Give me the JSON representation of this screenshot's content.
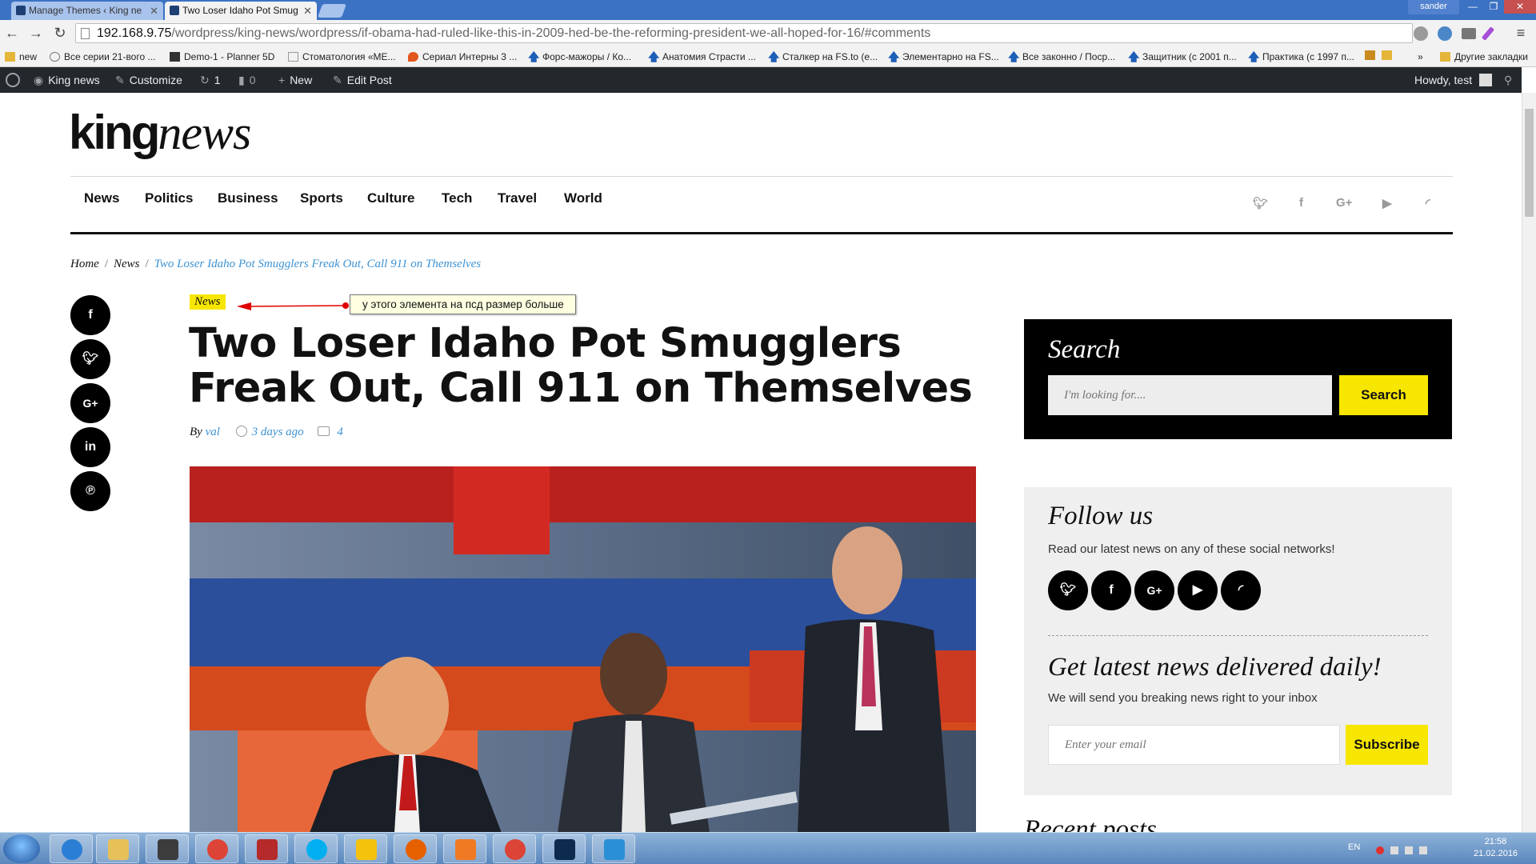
{
  "browser": {
    "tabs": [
      {
        "title": "Manage Themes ‹ King ne"
      },
      {
        "title": "Two Loser Idaho Pot Smug"
      }
    ],
    "profile_name": "sander",
    "url_host": "192.168.9.75",
    "url_path": "/wordpress/king-news/wordpress/if-obama-had-ruled-like-this-in-2009-hed-be-the-reforming-president-we-all-hoped-for-16/#comments",
    "bookmarks": [
      "new",
      "Все серии 21-вого ...",
      "Demo-1 - Planner 5D",
      "Стоматология «МЕ...",
      "Сериал Интерны 3 ...",
      "Форс-мажоры / Ко...",
      "Анатомия Страсти ...",
      "Сталкер на FS.to (е...",
      "Элементарно на FS...",
      "Все законно / Поср...",
      "Защитник (с 2001 п...",
      "Практика (с 1997 п..."
    ],
    "bookmarks_overflow": "»",
    "other_bookmarks": "Другие закладки"
  },
  "adminbar": {
    "site_name": "King news",
    "customize": "Customize",
    "updates": "1",
    "comments": "0",
    "new": "New",
    "edit_post": "Edit Post",
    "howdy": "Howdy, test"
  },
  "site": {
    "logo_bold": "king",
    "logo_italic": "news",
    "nav": [
      "News",
      "Politics",
      "Business",
      "Sports",
      "Culture",
      "Tech",
      "Travel",
      "World"
    ],
    "top_social_icons": [
      "twitter-icon",
      "facebook-icon",
      "google-plus-icon",
      "youtube-icon",
      "rss-icon"
    ]
  },
  "breadcrumb": {
    "home": "Home",
    "section": "News",
    "current": "Two Loser Idaho Pot Smugglers Freak Out, Call 911 on Themselves",
    "separator": "/"
  },
  "share_icons": [
    "facebook-icon",
    "twitter-icon",
    "google-plus-icon",
    "linkedin-icon",
    "pinterest-icon"
  ],
  "article": {
    "category": "News",
    "annotation": "у этого элемента на псд размер больше",
    "title": "Two Loser Idaho Pot Smugglers Freak Out, Call 911 on Themselves",
    "by": "By",
    "author": "val",
    "date": "3 days ago",
    "comments": "4"
  },
  "sidebar": {
    "search_title": "Search",
    "search_placeholder": "I'm looking for....",
    "search_button": "Search",
    "follow_title": "Follow us",
    "follow_text": "Read our latest news on any of these social networks!",
    "follow_icons": [
      "twitter-icon",
      "facebook-icon",
      "google-plus-icon",
      "youtube-icon",
      "rss-icon"
    ],
    "newsletter_title": "Get latest news delivered daily!",
    "newsletter_text": "We will send you breaking news right to your inbox",
    "email_placeholder": "Enter your email",
    "subscribe_button": "Subscribe",
    "recent_title_peek": "Recent posts"
  },
  "taskbar": {
    "lang": "EN",
    "time": "21:58",
    "date": "21.02.2016"
  },
  "colors": {
    "accent_yellow": "#f7e600",
    "link_blue": "#3d92d3",
    "adminbar": "#23282d"
  }
}
